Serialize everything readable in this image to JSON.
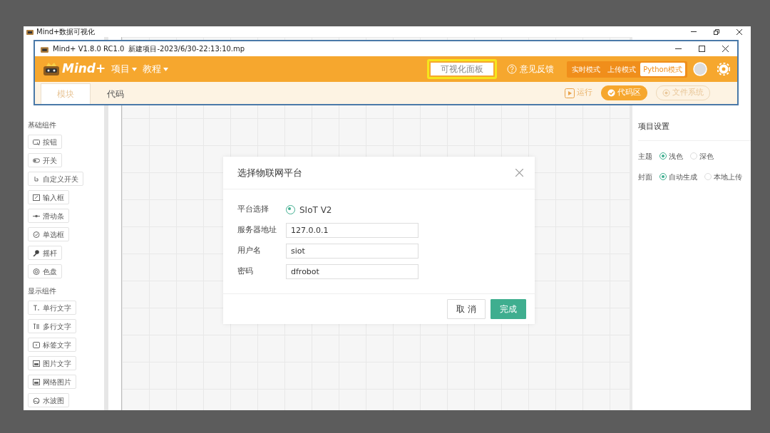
{
  "outer_window": {
    "title": "Mind+数据可视化"
  },
  "app_window": {
    "title": "Mind+ V1.8.0 RC1.0",
    "file": "新建项目-2023/6/30-22:13:10.mp",
    "logo": "Mind+",
    "menus": [
      {
        "label": "项目"
      },
      {
        "label": "教程"
      }
    ],
    "panel_button": {
      "label": "可视化面板",
      "highlighted": true
    },
    "feedback": "意见反馈",
    "modes": [
      {
        "label": "实时模式",
        "selected": false
      },
      {
        "label": "上传模式",
        "selected": false
      },
      {
        "label": "Python模式",
        "selected": true
      }
    ],
    "tabs": [
      {
        "label": "模块",
        "selected": true
      },
      {
        "label": "代码",
        "selected": false
      }
    ],
    "toolbar": [
      {
        "label": "运行",
        "kind": "run"
      },
      {
        "label": "代码区",
        "kind": "toggle",
        "selected": true
      },
      {
        "label": "文件系统",
        "kind": "toggle",
        "selected": false
      }
    ]
  },
  "palette": {
    "sections": [
      {
        "title": "基础组件",
        "items": [
          {
            "label": "按钮",
            "kind": "button"
          },
          {
            "label": "开关",
            "kind": "switch"
          },
          {
            "label": "自定义开关",
            "kind": "hand"
          },
          {
            "label": "输入框",
            "kind": "input"
          },
          {
            "label": "滑动条",
            "kind": "slider"
          },
          {
            "label": "单选框",
            "kind": "radio"
          },
          {
            "label": "摇杆",
            "kind": "joystick"
          },
          {
            "label": "色盘",
            "kind": "color"
          }
        ]
      },
      {
        "title": "显示组件",
        "items": [
          {
            "label": "单行文字",
            "kind": "text"
          },
          {
            "label": "多行文字",
            "kind": "textarea"
          },
          {
            "label": "标签文字",
            "kind": "label"
          },
          {
            "label": "图片文字",
            "kind": "image"
          },
          {
            "label": "网络图片",
            "kind": "image"
          },
          {
            "label": "水波图",
            "kind": "wave"
          }
        ]
      }
    ]
  },
  "settings": {
    "title": "项目设置",
    "rows": [
      {
        "label": "主题",
        "options": [
          {
            "label": "浅色",
            "selected": true
          },
          {
            "label": "深色",
            "selected": false
          }
        ]
      },
      {
        "label": "封面",
        "options": [
          {
            "label": "自动生成",
            "selected": true
          },
          {
            "label": "本地上传",
            "selected": false
          }
        ]
      }
    ]
  },
  "dialog": {
    "title": "选择物联网平台",
    "fields": [
      {
        "label": "平台选择",
        "kind": "radio",
        "value": "SIoT V2",
        "selected": true
      },
      {
        "label": "服务器地址",
        "kind": "text",
        "value": "127.0.0.1"
      },
      {
        "label": "用户名",
        "kind": "text",
        "value": "siot"
      },
      {
        "label": "密码",
        "kind": "text",
        "value": "dfrobot"
      }
    ],
    "buttons": [
      {
        "label": "取 消",
        "kind": "secondary"
      },
      {
        "label": "完成",
        "kind": "primary"
      }
    ]
  }
}
